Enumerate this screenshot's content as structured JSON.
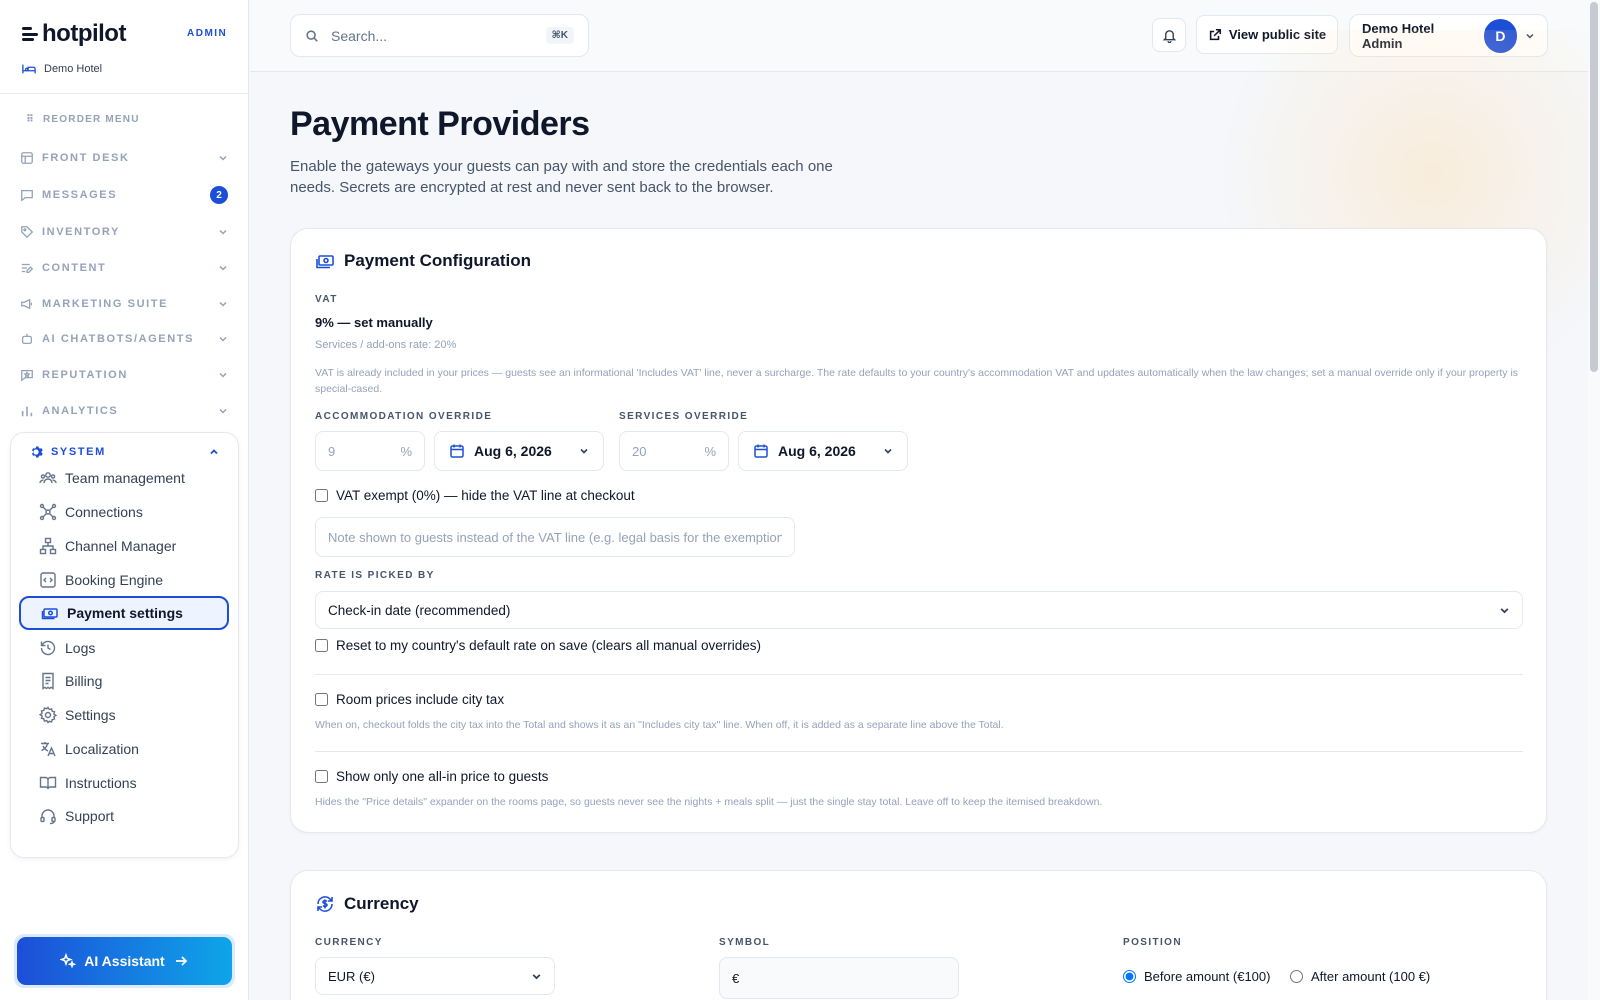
{
  "brand": {
    "name": "hotpilot",
    "role_tag": "ADMIN",
    "hotel": "Demo Hotel"
  },
  "sidebar": {
    "reorder_label": "REORDER MENU",
    "groups": [
      {
        "label": "FRONT DESK",
        "icon": "front-desk-icon"
      },
      {
        "label": "MESSAGES",
        "icon": "messages-icon",
        "badge": "2"
      },
      {
        "label": "INVENTORY",
        "icon": "tag-icon"
      },
      {
        "label": "CONTENT",
        "icon": "content-icon"
      },
      {
        "label": "MARKETING SUITE",
        "icon": "megaphone-icon"
      },
      {
        "label": "AI CHATBOTS/AGENTS",
        "icon": "bot-icon"
      },
      {
        "label": "REPUTATION",
        "icon": "reputation-icon"
      },
      {
        "label": "ANALYTICS",
        "icon": "bar-chart-icon"
      }
    ],
    "system": {
      "label": "SYSTEM",
      "items": [
        {
          "label": "Team management",
          "icon": "team-icon"
        },
        {
          "label": "Connections",
          "icon": "network-icon"
        },
        {
          "label": "Channel Manager",
          "icon": "sitemap-icon"
        },
        {
          "label": "Booking Engine",
          "icon": "code-window-icon"
        },
        {
          "label": "Payment settings",
          "icon": "cash-icon",
          "active": true
        },
        {
          "label": "Logs",
          "icon": "history-icon"
        },
        {
          "label": "Billing",
          "icon": "receipt-icon"
        },
        {
          "label": "Settings",
          "icon": "gear-icon"
        },
        {
          "label": "Localization",
          "icon": "translate-icon"
        },
        {
          "label": "Instructions",
          "icon": "book-icon"
        },
        {
          "label": "Support",
          "icon": "headset-icon"
        }
      ]
    },
    "ai_assistant": "AI Assistant"
  },
  "topbar": {
    "search_placeholder": "Search...",
    "search_shortcut": "⌘K",
    "view_public_site": "View public site",
    "user_name": "Demo Hotel Admin",
    "user_initial": "D"
  },
  "page": {
    "title": "Payment Providers",
    "description": "Enable the gateways your guests can pay with and store the credentials each one needs. Secrets are encrypted at rest and never sent back to the browser."
  },
  "payment_config": {
    "title": "Payment Configuration",
    "vat_label": "VAT",
    "vat_value": "9% — set manually",
    "vat_services": "Services / add-ons rate: 20%",
    "vat_note": "VAT is already included in your prices — guests see an informational 'Includes VAT' line, never a surcharge. The rate defaults to your country's accommodation VAT and updates automatically when the law changes; set a manual override only if your property is special-cased.",
    "accommodation_override_label": "ACCOMMODATION OVERRIDE",
    "accommodation_value": "9",
    "accommodation_date": "Aug 6, 2026",
    "services_override_label": "SERVICES OVERRIDE",
    "services_value": "20",
    "services_date": "Aug 6, 2026",
    "percent_symbol": "%",
    "vat_exempt_label": "VAT exempt (0%) — hide the VAT line at checkout",
    "note_placeholder": "Note shown to guests instead of the VAT line (e.g. legal basis for the exemption)",
    "rate_picked_label": "RATE IS PICKED BY",
    "rate_picked_value": "Check-in date (recommended)",
    "reset_label": "Reset to my country's default rate on save (clears all manual overrides)",
    "city_tax_label": "Room prices include city tax",
    "city_tax_help": "When on, checkout folds the city tax into the Total and shows it as an \"Includes city tax\" line. When off, it is added as a separate line above the Total.",
    "all_in_label": "Show only one all-in price to guests",
    "all_in_help": "Hides the \"Price details\" expander on the rooms page, so guests never see the nights + meals split — just the single stay total. Leave off to keep the itemised breakdown."
  },
  "currency": {
    "title": "Currency",
    "currency_label": "CURRENCY",
    "currency_value": "EUR (€)",
    "symbol_label": "SYMBOL",
    "symbol_value": "€",
    "position_label": "POSITION",
    "position_before": "Before amount (€100)",
    "position_after": "After amount (100 €)"
  },
  "colors": {
    "accent": "#1d4ed8",
    "accent_light": "#eef4ff",
    "muted": "#94a3b8",
    "border": "#e2e8f0"
  }
}
